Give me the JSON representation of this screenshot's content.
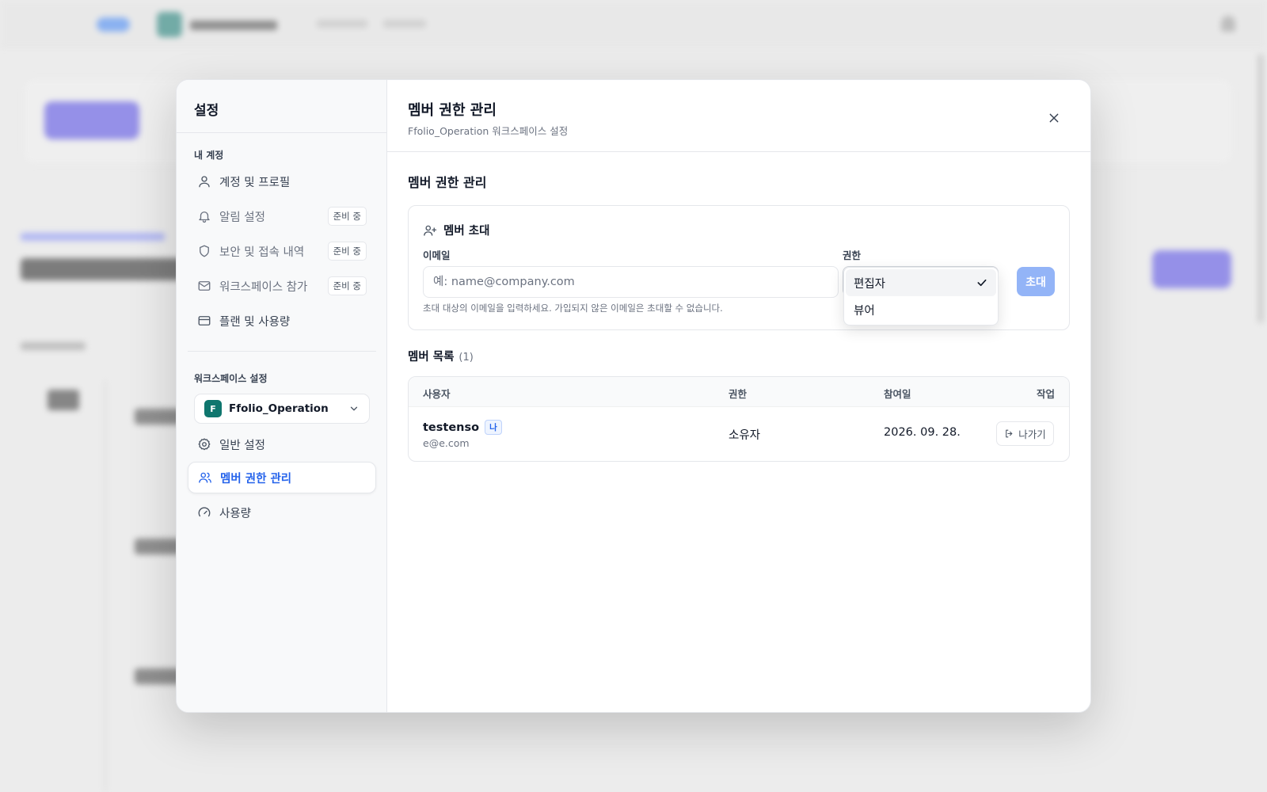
{
  "modal": {
    "sidebar_title": "설정",
    "my_account_section": "내 계정",
    "account_items": [
      {
        "label": "계정 및 프로필",
        "badge": "",
        "icon": "user-icon"
      },
      {
        "label": "알림 설정",
        "badge": "준비 중",
        "icon": "bell-icon"
      },
      {
        "label": "보안 및 접속 내역",
        "badge": "준비 중",
        "icon": "shield-icon"
      },
      {
        "label": "워크스페이스 참가",
        "badge": "준비 중",
        "icon": "mail-icon"
      },
      {
        "label": "플랜 및 사용량",
        "badge": "",
        "icon": "credit-card-icon"
      }
    ],
    "workspace_section": "워크스페이스 설정",
    "workspace_select": {
      "avatar": "F",
      "name": "Ffolio_Operation",
      "icon": "chevron-down-icon"
    },
    "workspace_items": [
      {
        "label": "일반 설정",
        "icon": "gear-icon"
      },
      {
        "label": "멤버 권한 관리",
        "icon": "users-icon",
        "active": true
      },
      {
        "label": "사용량",
        "icon": "gauge-icon"
      }
    ]
  },
  "header": {
    "title": "멤버 권한 관리",
    "subtitle": "Ffolio_Operation 워크스페이스 설정"
  },
  "section_title": "멤버 권한 관리",
  "invite": {
    "title": "멤버 초대",
    "email_label": "이메일",
    "email_placeholder": "예: name@company.com",
    "hint": "초대 대상의 이메일을 입력하세요. 가입되지 않은 이메일은 초대할 수 없습니다.",
    "role_label": "권한",
    "button_label": "초대",
    "role_options": [
      "편집자",
      "뷰어"
    ],
    "selected_role": "편집자"
  },
  "members": {
    "title": "멤버 목록",
    "count": "(1)",
    "columns": [
      "사용자",
      "권한",
      "참여일",
      "작업"
    ],
    "rows": [
      {
        "name": "testenso",
        "me_badge": "나",
        "email": "e@e.com",
        "role": "소유자",
        "joined": "2026. 09. 28.",
        "action": "나가기"
      }
    ]
  },
  "colors": {
    "accent": "#2563eb",
    "invite_button": "#93b4f7",
    "workspace_avatar": "#0f766e"
  }
}
